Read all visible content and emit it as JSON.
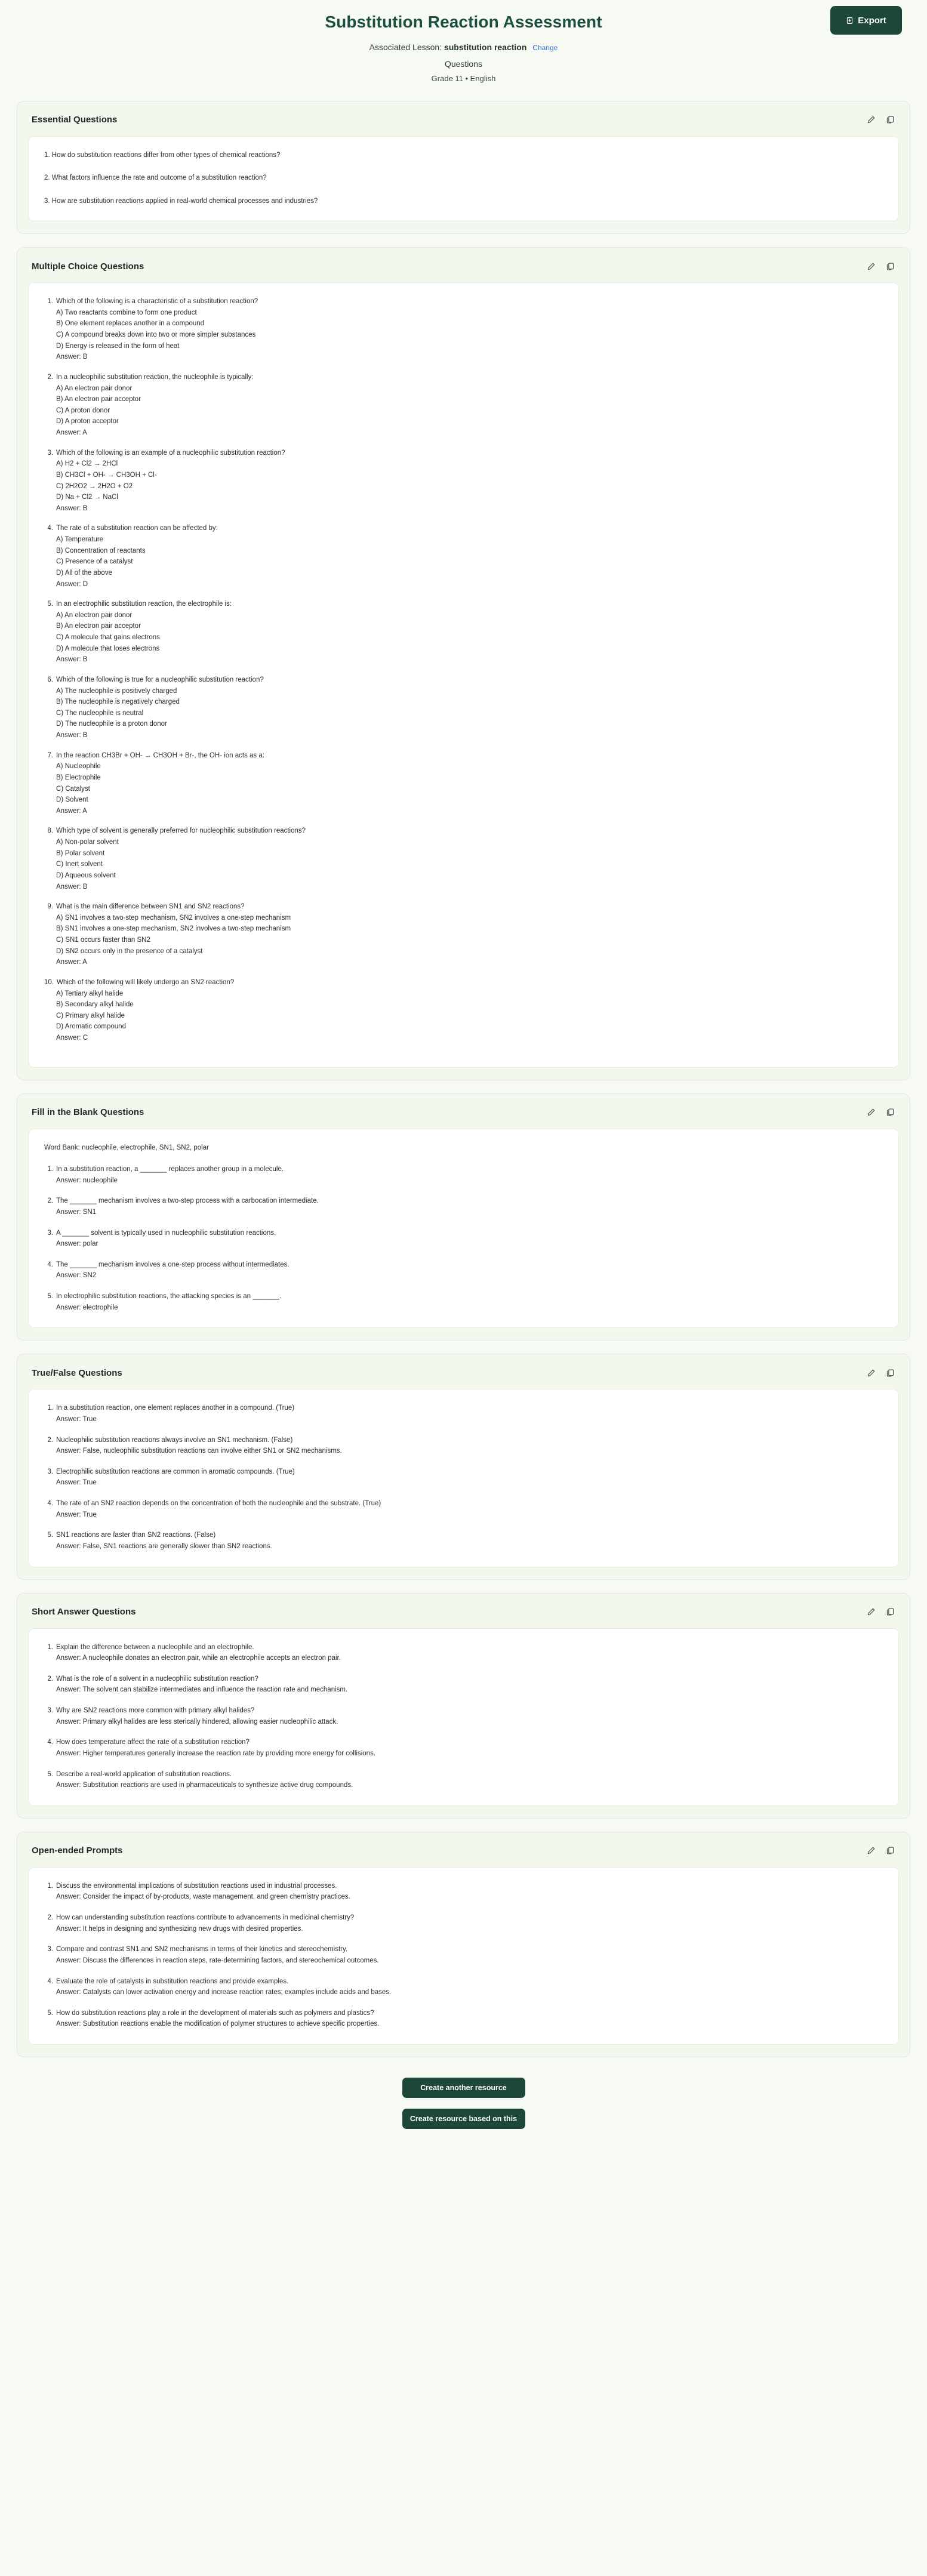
{
  "header": {
    "title": "Substitution Reaction Assessment",
    "export_label": "Export",
    "export_icon": "export-icon",
    "lesson_label": "Associated Lesson:",
    "lesson_name": "substitution reaction",
    "change_label": "Change",
    "resource_type": "Questions",
    "grade_language": "Grade 11 • English"
  },
  "icons": {
    "edit": "edit-pencil-icon",
    "copy": "copy-icon"
  },
  "sections": [
    {
      "id": "essential-questions",
      "title": "Essential Questions",
      "kind": "plain",
      "items": [
        "1. How do substitution reactions differ from other types of chemical reactions?",
        "2. What factors influence the rate and outcome of a substitution reaction?",
        "3. How are substitution reactions applied in real-world chemical processes and industries?"
      ]
    },
    {
      "id": "multiple-choice-questions",
      "title": "Multiple Choice Questions",
      "kind": "mc",
      "questions": [
        {
          "num": "1.",
          "text": "Which of the following is a characteristic of a substitution reaction?",
          "options": [
            "A) Two reactants combine to form one product",
            "B) One element replaces another in a compound",
            "C) A compound breaks down into two or more simpler substances",
            "D) Energy is released in the form of heat"
          ],
          "answer": "Answer: B"
        },
        {
          "num": "2.",
          "text": "In a nucleophilic substitution reaction, the nucleophile is typically:",
          "options": [
            "A) An electron pair donor",
            "B) An electron pair acceptor",
            "C) A proton donor",
            "D) A proton acceptor"
          ],
          "answer": "Answer: A"
        },
        {
          "num": "3.",
          "text": "Which of the following is an example of a nucleophilic substitution reaction?",
          "options": [
            "A) H2 + Cl2 → 2HCl",
            "B) CH3Cl + OH- → CH3OH + Cl-",
            "C) 2H2O2 → 2H2O + O2",
            "D) Na + Cl2 → NaCl"
          ],
          "answer": "Answer: B"
        },
        {
          "num": "4.",
          "text": "The rate of a substitution reaction can be affected by:",
          "options": [
            "A) Temperature",
            "B) Concentration of reactants",
            "C) Presence of a catalyst",
            "D) All of the above"
          ],
          "answer": "Answer: D"
        },
        {
          "num": "5.",
          "text": "In an electrophilic substitution reaction, the electrophile is:",
          "options": [
            "A) An electron pair donor",
            "B) An electron pair acceptor",
            "C) A molecule that gains electrons",
            "D) A molecule that loses electrons"
          ],
          "answer": "Answer: B"
        },
        {
          "num": "6.",
          "text": "Which of the following is true for a nucleophilic substitution reaction?",
          "options": [
            "A) The nucleophile is positively charged",
            "B) The nucleophile is negatively charged",
            "C) The nucleophile is neutral",
            "D) The nucleophile is a proton donor"
          ],
          "answer": "Answer: B"
        },
        {
          "num": "7.",
          "text": "In the reaction CH3Br + OH- → CH3OH + Br-, the OH- ion acts as a:",
          "options": [
            "A) Nucleophile",
            "B) Electrophile",
            "C) Catalyst",
            "D) Solvent"
          ],
          "answer": "Answer: A"
        },
        {
          "num": "8.",
          "text": "Which type of solvent is generally preferred for nucleophilic substitution reactions?",
          "options": [
            "A) Non-polar solvent",
            "B) Polar solvent",
            "C) Inert solvent",
            "D) Aqueous solvent"
          ],
          "answer": "Answer: B"
        },
        {
          "num": "9.",
          "text": "What is the main difference between SN1 and SN2 reactions?",
          "options": [
            "A) SN1 involves a two-step mechanism, SN2 involves a one-step mechanism",
            "B) SN1 involves a one-step mechanism, SN2 involves a two-step mechanism",
            "C) SN1 occurs faster than SN2",
            "D) SN2 occurs only in the presence of a catalyst"
          ],
          "answer": "Answer: A"
        },
        {
          "num": "10.",
          "text": "Which of the following will likely undergo an SN2 reaction?",
          "options": [
            "A) Tertiary alkyl halide",
            "B) Secondary alkyl halide",
            "C) Primary alkyl halide",
            "D) Aromatic compound"
          ],
          "answer": "Answer: C"
        }
      ]
    },
    {
      "id": "fill-in-the-blank-questions",
      "title": "Fill in the Blank Questions",
      "kind": "qa",
      "intro": "Word Bank: nucleophile, electrophile, SN1, SN2, polar",
      "questions": [
        {
          "num": "1.",
          "text": "In a substitution reaction, a _______ replaces another group in a molecule.",
          "answer": "Answer: nucleophile"
        },
        {
          "num": "2.",
          "text": "The _______ mechanism involves a two-step process with a carbocation intermediate.",
          "answer": "Answer: SN1"
        },
        {
          "num": "3.",
          "text": "A _______ solvent is typically used in nucleophilic substitution reactions.",
          "answer": "Answer: polar"
        },
        {
          "num": "4.",
          "text": "The _______ mechanism involves a one-step process without intermediates.",
          "answer": "Answer: SN2"
        },
        {
          "num": "5.",
          "text": "In electrophilic substitution reactions, the attacking species is an _______.",
          "answer": "Answer: electrophile"
        }
      ]
    },
    {
      "id": "true-false-questions",
      "title": "True/False Questions",
      "kind": "qa",
      "intro": "",
      "questions": [
        {
          "num": "1.",
          "text": "In a substitution reaction, one element replaces another in a compound. (True)",
          "answer": "Answer: True"
        },
        {
          "num": "2.",
          "text": "Nucleophilic substitution reactions always involve an SN1 mechanism. (False)",
          "answer": "Answer: False, nucleophilic substitution reactions can involve either SN1 or SN2 mechanisms."
        },
        {
          "num": "3.",
          "text": "Electrophilic substitution reactions are common in aromatic compounds. (True)",
          "answer": "Answer: True"
        },
        {
          "num": "4.",
          "text": "The rate of an SN2 reaction depends on the concentration of both the nucleophile and the substrate. (True)",
          "answer": "Answer: True"
        },
        {
          "num": "5.",
          "text": "SN1 reactions are faster than SN2 reactions. (False)",
          "answer": "Answer: False, SN1 reactions are generally slower than SN2 reactions."
        }
      ]
    },
    {
      "id": "short-answer-questions",
      "title": "Short Answer Questions",
      "kind": "qa",
      "intro": "",
      "questions": [
        {
          "num": "1.",
          "text": "Explain the difference between a nucleophile and an electrophile.",
          "answer": "Answer: A nucleophile donates an electron pair, while an electrophile accepts an electron pair."
        },
        {
          "num": "2.",
          "text": "What is the role of a solvent in a nucleophilic substitution reaction?",
          "answer": "Answer: The solvent can stabilize intermediates and influence the reaction rate and mechanism."
        },
        {
          "num": "3.",
          "text": "Why are SN2 reactions more common with primary alkyl halides?",
          "answer": "Answer: Primary alkyl halides are less sterically hindered, allowing easier nucleophilic attack."
        },
        {
          "num": "4.",
          "text": "How does temperature affect the rate of a substitution reaction?",
          "answer": "Answer: Higher temperatures generally increase the reaction rate by providing more energy for collisions."
        },
        {
          "num": "5.",
          "text": "Describe a real-world application of substitution reactions.",
          "answer": "Answer: Substitution reactions are used in pharmaceuticals to synthesize active drug compounds."
        }
      ]
    },
    {
      "id": "open-ended-prompts",
      "title": "Open-ended Prompts",
      "kind": "qa",
      "intro": "",
      "questions": [
        {
          "num": "1.",
          "text": "Discuss the environmental implications of substitution reactions used in industrial processes.",
          "answer": "Answer: Consider the impact of by-products, waste management, and green chemistry practices."
        },
        {
          "num": "2.",
          "text": "How can understanding substitution reactions contribute to advancements in medicinal chemistry?",
          "answer": "Answer: It helps in designing and synthesizing new drugs with desired properties."
        },
        {
          "num": "3.",
          "text": "Compare and contrast SN1 and SN2 mechanisms in terms of their kinetics and stereochemistry.",
          "answer": "Answer: Discuss the differences in reaction steps, rate-determining factors, and stereochemical outcomes."
        },
        {
          "num": "4.",
          "text": "Evaluate the role of catalysts in substitution reactions and provide examples.",
          "answer": "Answer: Catalysts can lower activation energy and increase reaction rates; examples include acids and bases."
        },
        {
          "num": "5.",
          "text": "How do substitution reactions play a role in the development of materials such as polymers and plastics?",
          "answer": "Answer: Substitution reactions enable the modification of polymer structures to achieve specific properties."
        }
      ]
    }
  ],
  "footer": {
    "create_another_label": "Create another resource",
    "create_based_label": "Create resource based on this"
  },
  "colors": {
    "brand_dark_green": "#1c4739",
    "title_green": "#1c4f3f",
    "page_background": "#f7faf3",
    "card_background": "#f3f8ee",
    "link_blue": "#2f6fd0"
  }
}
